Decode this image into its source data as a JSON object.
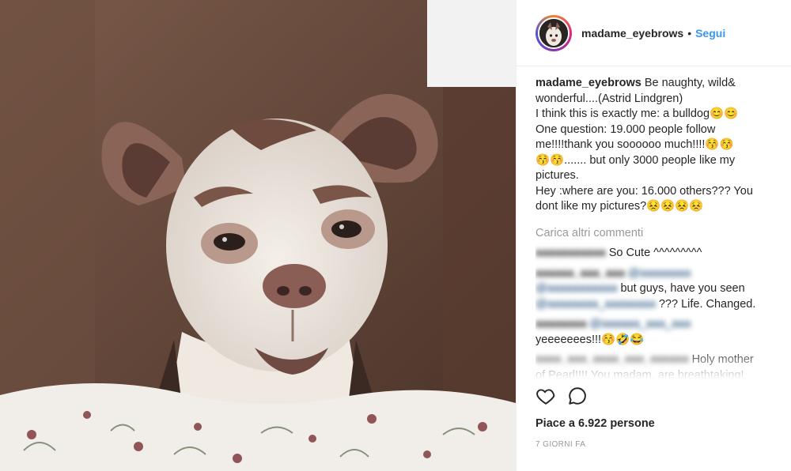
{
  "header": {
    "username": "madame_eyebrows",
    "separator": "•",
    "follow_label": "Segui"
  },
  "caption": {
    "username": "madame_eyebrows",
    "lines": [
      "Be naughty, wild&",
      "wonderful....(Astrid Lindgren)",
      "I think this is exactly me: a bulldog😊😊",
      "One question: 19.000 people follow",
      "me!!!!thank you soooooo much!!!!😚😚",
      "😚😚....... but only 3000 people like my",
      "pictures.",
      "Hey :where are you: 16.000 others??? You",
      "dont like my pictures?😣😣😣😣"
    ]
  },
  "load_more": "Carica altri commenti",
  "comments": [
    {
      "user_blurred": "aaaaaaaaaaa",
      "text": "So Cute ^^^^^^^^^"
    },
    {
      "user_blurred": "aaaaaa_aaa_aaa",
      "mention1_blurred": "@aaaaaaaa",
      "mention2_blurred": "@aaaaaaaaaaa",
      "text": "but guys, have you seen",
      "mention3_blurred": "@aaaaaaaa_aaaaaaaa",
      "text2": "??? Life. Changed."
    },
    {
      "user_blurred": "aaaaaaaa",
      "mention_blurred": "@aaaaaa_aaa_aaa",
      "text": "yeeeeeees!!!😚🤣😂"
    },
    {
      "user_blurred": "aaaa_aaa_aaaa_aaa_aaaaaa",
      "text": "Holy mother",
      "text2": "of Pearl!!!! You madam, are breathtaking!"
    }
  ],
  "likes": "Piace a 6.922 persone",
  "timestamp": "7 GIORNI FA",
  "icons": {
    "like": "heart-icon",
    "comment": "comment-icon"
  }
}
